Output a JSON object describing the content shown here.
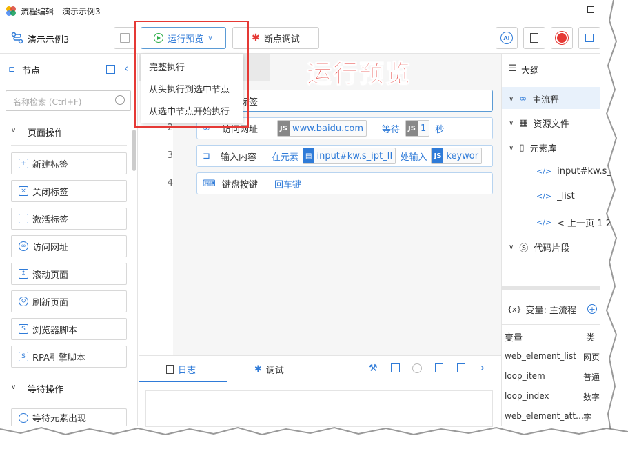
{
  "window": {
    "title": "流程编辑 - 演示示例3"
  },
  "toolbar": {
    "project_name": "演示示例3",
    "run_preview_label": "运行预览",
    "debug_label": "断点调试",
    "ai_label": "AI"
  },
  "dropdown": {
    "items": [
      "完整执行",
      "从头执行到选中节点",
      "从选中节点开始执行"
    ]
  },
  "annotation": {
    "text": "运行预览"
  },
  "left_panel": {
    "title": "节点",
    "search_placeholder": "名称检索 (Ctrl+F)",
    "group1": "页面操作",
    "items": [
      "新建标签",
      "关闭标签",
      "激活标签",
      "访问网址",
      "滚动页面",
      "刷新页面",
      "浏览器脚本",
      "RPA引擎脚本"
    ],
    "group2": "等待操作",
    "partial_item": "等待元素出现"
  },
  "flow": {
    "rows": [
      {
        "num": "1",
        "label": "标签"
      },
      {
        "num": "2",
        "label": "访问网址",
        "url": "www.baidu.com",
        "wait": "等待",
        "wait_val": "1",
        "unit": "秒",
        "js": "JS"
      },
      {
        "num": "3",
        "label": "输入内容",
        "at": "在元素",
        "element": "input#kw.s_ipt_INI",
        "input": "处输入",
        "js": "JS",
        "value": "keywor"
      },
      {
        "num": "4",
        "label": "键盘按键",
        "key": "回车键"
      }
    ]
  },
  "log_panel": {
    "tab_log": "日志",
    "tab_debug": "调试"
  },
  "right_panel": {
    "outline_title": "大纲",
    "tree": [
      "主流程",
      "资源文件",
      "元素库",
      "input#kw.s_",
      "_list",
      "< 上一页 1 2",
      "代码片段"
    ],
    "vars_title": "变量: 主流程",
    "vars_header": [
      "变量",
      "类"
    ],
    "vars": [
      {
        "name": "web_element_list",
        "type": "网页"
      },
      {
        "name": "loop_item",
        "type": "普通"
      },
      {
        "name": "loop_index",
        "type": "数字"
      },
      {
        "name": "web_element_att…",
        "type": "字"
      }
    ]
  },
  "colors": {
    "accent": "#2f7bd8",
    "highlight": "#e53935"
  }
}
